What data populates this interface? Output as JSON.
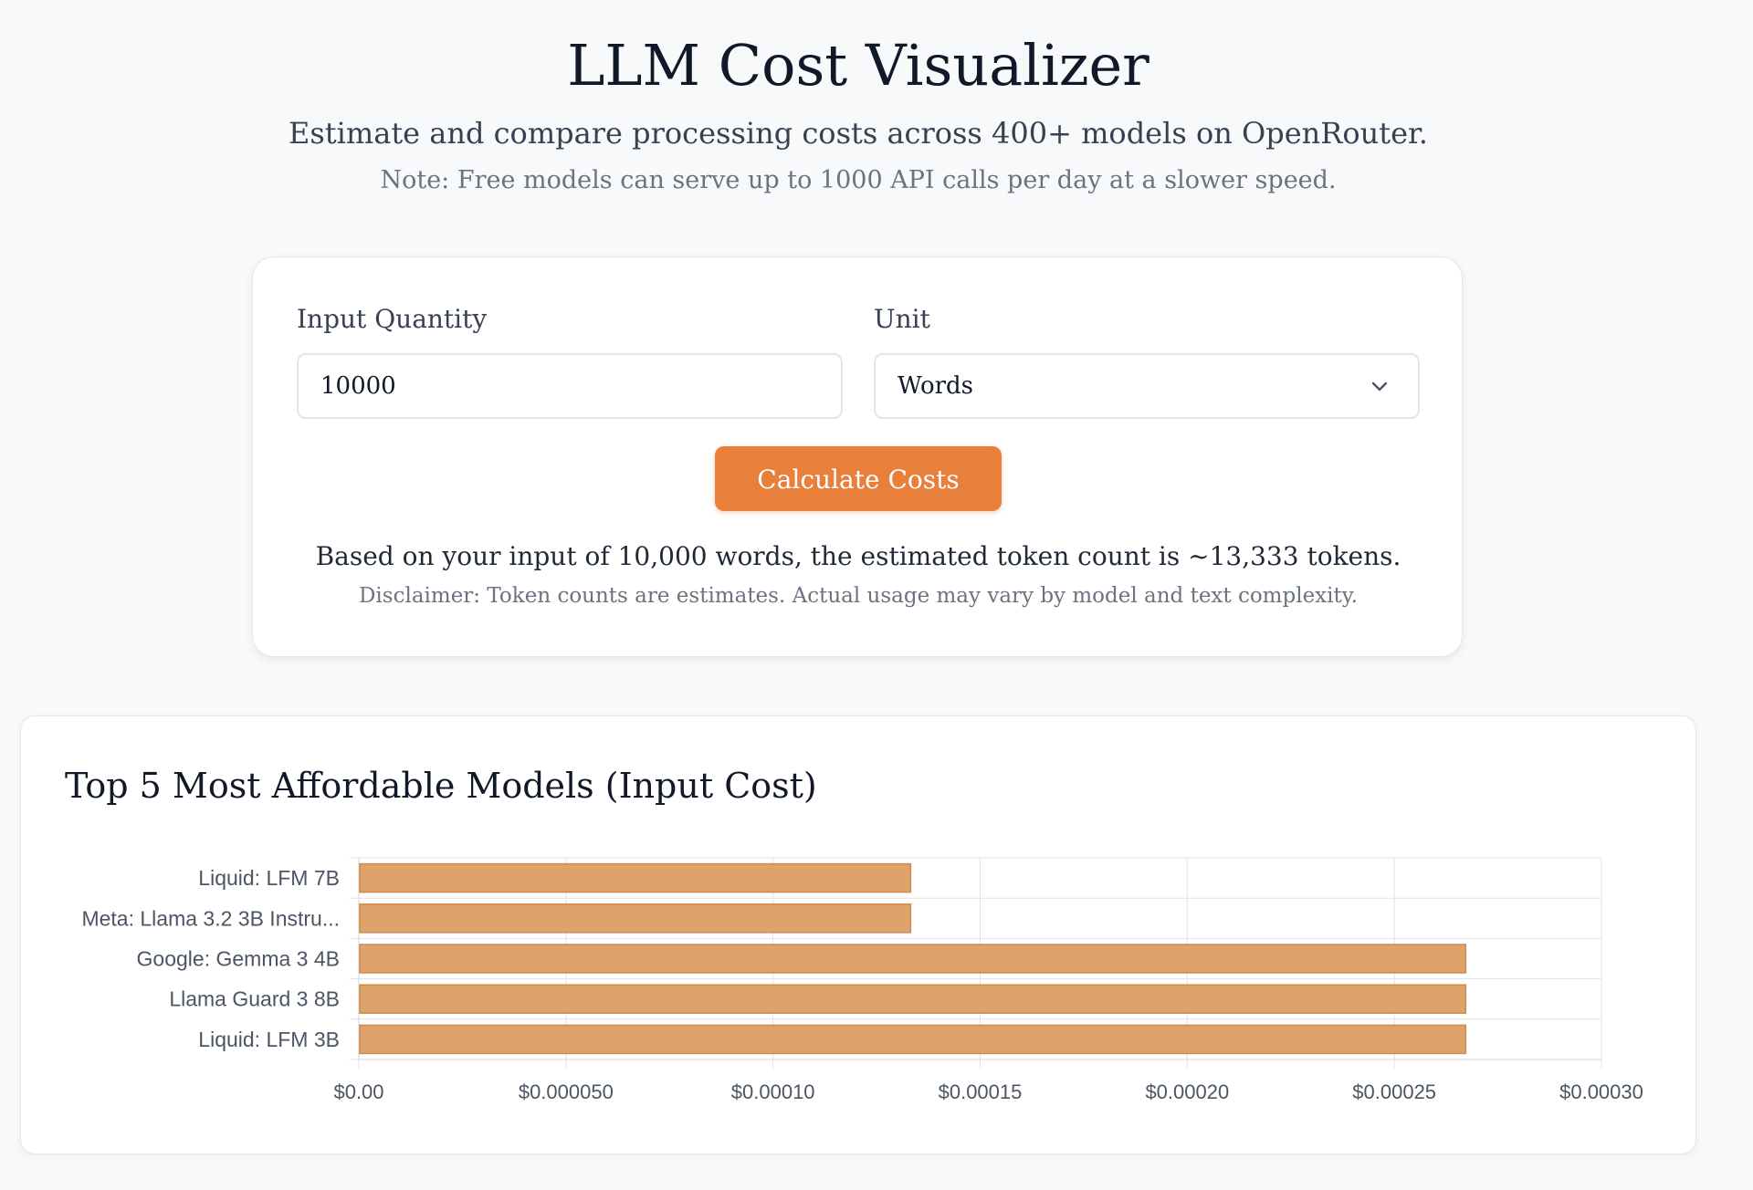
{
  "header": {
    "title": "LLM Cost Visualizer",
    "subtitle": "Estimate and compare processing costs across 400+ models on OpenRouter.",
    "note": "Note: Free models can serve up to 1000 API calls per day at a slower speed."
  },
  "form": {
    "quantity_label": "Input Quantity",
    "quantity_value": "10000",
    "unit_label": "Unit",
    "unit_value": "Words",
    "calculate_label": "Calculate Costs",
    "estimate_text": "Based on your input of 10,000 words, the estimated token count is ~13,333 tokens.",
    "disclaimer_text": "Disclaimer: Token counts are estimates. Actual usage may vary by model and text complexity."
  },
  "chart": {
    "title": "Top 5 Most Affordable Models (Input Cost)"
  },
  "chart_data": {
    "type": "bar",
    "orientation": "horizontal",
    "categories": [
      "Liquid: LFM 7B",
      "Meta: Llama 3.2 3B Instru...",
      "Google: Gemma 3 4B",
      "Llama Guard 3 8B",
      "Liquid: LFM 3B"
    ],
    "values": [
      0.000133,
      0.000133,
      0.000267,
      0.000267,
      0.000267
    ],
    "xlim": [
      0,
      0.0003
    ],
    "xticks": [
      0,
      5e-05,
      0.0001,
      0.00015,
      0.0002,
      0.00025,
      0.0003
    ],
    "xtick_labels": [
      "$0.00",
      "$0.000050",
      "$0.00010",
      "$0.00015",
      "$0.00020",
      "$0.00025",
      "$0.00030"
    ],
    "grid": true,
    "bar_color": "#dda36b",
    "bar_border": "#d08a4c"
  },
  "colors": {
    "accent": "#e87f3a",
    "background": "#f8f9fb"
  }
}
